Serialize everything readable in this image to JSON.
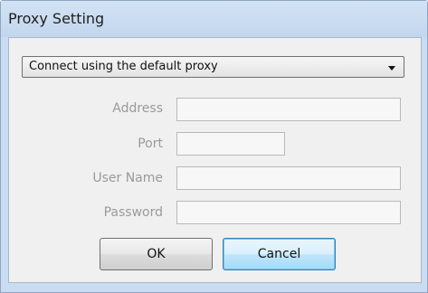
{
  "window": {
    "title": "Proxy Setting"
  },
  "proxy_select": {
    "selected": "Connect using the default proxy"
  },
  "fields": {
    "address": {
      "label": "Address",
      "value": ""
    },
    "port": {
      "label": "Port",
      "value": ""
    },
    "user_name": {
      "label": "User Name",
      "value": ""
    },
    "password": {
      "label": "Password",
      "value": ""
    }
  },
  "buttons": {
    "ok": "OK",
    "cancel": "Cancel"
  },
  "icons": {
    "dropdown": "chevron-down-icon"
  },
  "colors": {
    "titlebar": "#c9dcf2",
    "client": "#f0f0f0",
    "disabled_label": "#9a9a9a",
    "cancel_focus": "#3c7fb1"
  }
}
